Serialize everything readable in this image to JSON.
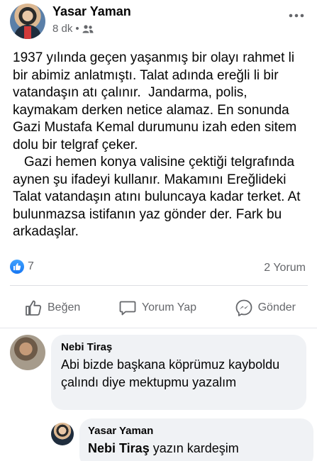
{
  "post": {
    "author": "Yasar Yaman",
    "time": "8 dk",
    "separator": "•",
    "paragraph1": "1937 yılında geçen yaşanmış bir olayı rahmet li bir abimiz anlatmıştı. Talat adında ereğli li bir vatandaşın atı çalınır.  Jandarma, polis, kaymakam derken netice alamaz. En sonunda Gazi Mustafa Kemal durumunu izah eden sitem dolu bir telgraf çeker.",
    "paragraph2": "   Gazi hemen konya valisine çektiği telgrafında   aynen şu ifadeyi kullanır. Makamını Ereğlideki Talat vatandaşın atını buluncaya kadar terket. At bulunmazsa istifanın yaz gönder der. Fark bu arkadaşlar."
  },
  "stats": {
    "reaction_count": "7",
    "comment_count": "2 Yorum"
  },
  "actions": {
    "like": "Beğen",
    "comment": "Yorum Yap",
    "share": "Gönder"
  },
  "comments": [
    {
      "author": "Nebi Tiraş",
      "text": "Abi bizde başkana köprümuz kayboldu çalındı diye mektupmu yazalım"
    },
    {
      "author": "Yasar Yaman",
      "tag": "Nebi Tiraş",
      "text": " yazın kardeşim"
    }
  ],
  "colors": {
    "accent": "#1877f2",
    "secondary_text": "#65676b",
    "bubble": "#f0f2f5"
  },
  "icons": {
    "privacy": "friends-icon",
    "more": "more-options-icon",
    "like": "thumbs-up-icon",
    "comment": "comment-bubble-icon",
    "share": "messenger-icon"
  }
}
